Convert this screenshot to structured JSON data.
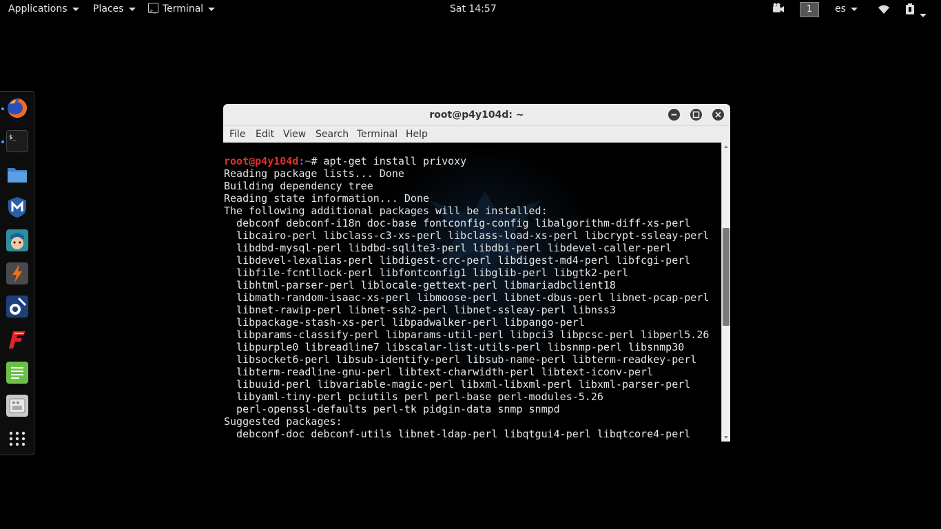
{
  "topbar": {
    "applications": "Applications",
    "places": "Places",
    "terminal": "Terminal",
    "clock": "Sat 14:57",
    "workspace": "1",
    "language": "es"
  },
  "dock": {
    "items": [
      {
        "name": "firefox-icon",
        "running": true
      },
      {
        "name": "terminal-icon",
        "running": true
      },
      {
        "name": "files-icon",
        "running": false
      },
      {
        "name": "metasploit-icon",
        "running": false
      },
      {
        "name": "armitage-icon",
        "running": false
      },
      {
        "name": "burpsuite-icon",
        "running": false
      },
      {
        "name": "maltego-icon",
        "running": false
      },
      {
        "name": "faraday-icon",
        "running": false
      },
      {
        "name": "leafpad-icon",
        "running": false
      },
      {
        "name": "cutycapt-icon",
        "running": false
      },
      {
        "name": "show-apps-icon",
        "running": false
      }
    ]
  },
  "window": {
    "title": "root@p4y104d: ~",
    "menu": [
      "File",
      "Edit",
      "View",
      "Search",
      "Terminal",
      "Help"
    ],
    "scroll_position": 0.42,
    "scroll_visible_fraction": 0.34
  },
  "terminal": {
    "prompt_user": "root@p4y104d",
    "prompt_path": ":~",
    "command": "# apt-get install privoxy",
    "output": [
      "Reading package lists... Done",
      "Building dependency tree",
      "Reading state information... Done",
      "The following additional packages will be installed:",
      "  debconf debconf-i18n doc-base fontconfig-config libalgorithm-diff-xs-perl",
      "  libcairo-perl libclass-c3-xs-perl libclass-load-xs-perl libcrypt-ssleay-perl",
      "  libdbd-mysql-perl libdbd-sqlite3-perl libdbi-perl libdevel-caller-perl",
      "  libdevel-lexalias-perl libdigest-crc-perl libdigest-md4-perl libfcgi-perl",
      "  libfile-fcntllock-perl libfontconfig1 libglib-perl libgtk2-perl",
      "  libhtml-parser-perl liblocale-gettext-perl libmariadbclient18",
      "  libmath-random-isaac-xs-perl libmoose-perl libnet-dbus-perl libnet-pcap-perl",
      "  libnet-rawip-perl libnet-ssh2-perl libnet-ssleay-perl libnss3",
      "  libpackage-stash-xs-perl libpadwalker-perl libpango-perl",
      "  libparams-classify-perl libparams-util-perl libpci3 libpcsc-perl libperl5.26",
      "  libpurple0 libreadline7 libscalar-list-utils-perl libsnmp-perl libsnmp30",
      "  libsocket6-perl libsub-identify-perl libsub-name-perl libterm-readkey-perl",
      "  libterm-readline-gnu-perl libtext-charwidth-perl libtext-iconv-perl",
      "  libuuid-perl libvariable-magic-perl libxml-libxml-perl libxml-parser-perl",
      "  libyaml-tiny-perl pciutils perl perl-base perl-modules-5.26",
      "  perl-openssl-defaults perl-tk pidgin-data snmp snmpd",
      "Suggested packages:",
      "  debconf-doc debconf-utils libnet-ldap-perl libqtgui4-perl libqtcore4-perl"
    ]
  }
}
